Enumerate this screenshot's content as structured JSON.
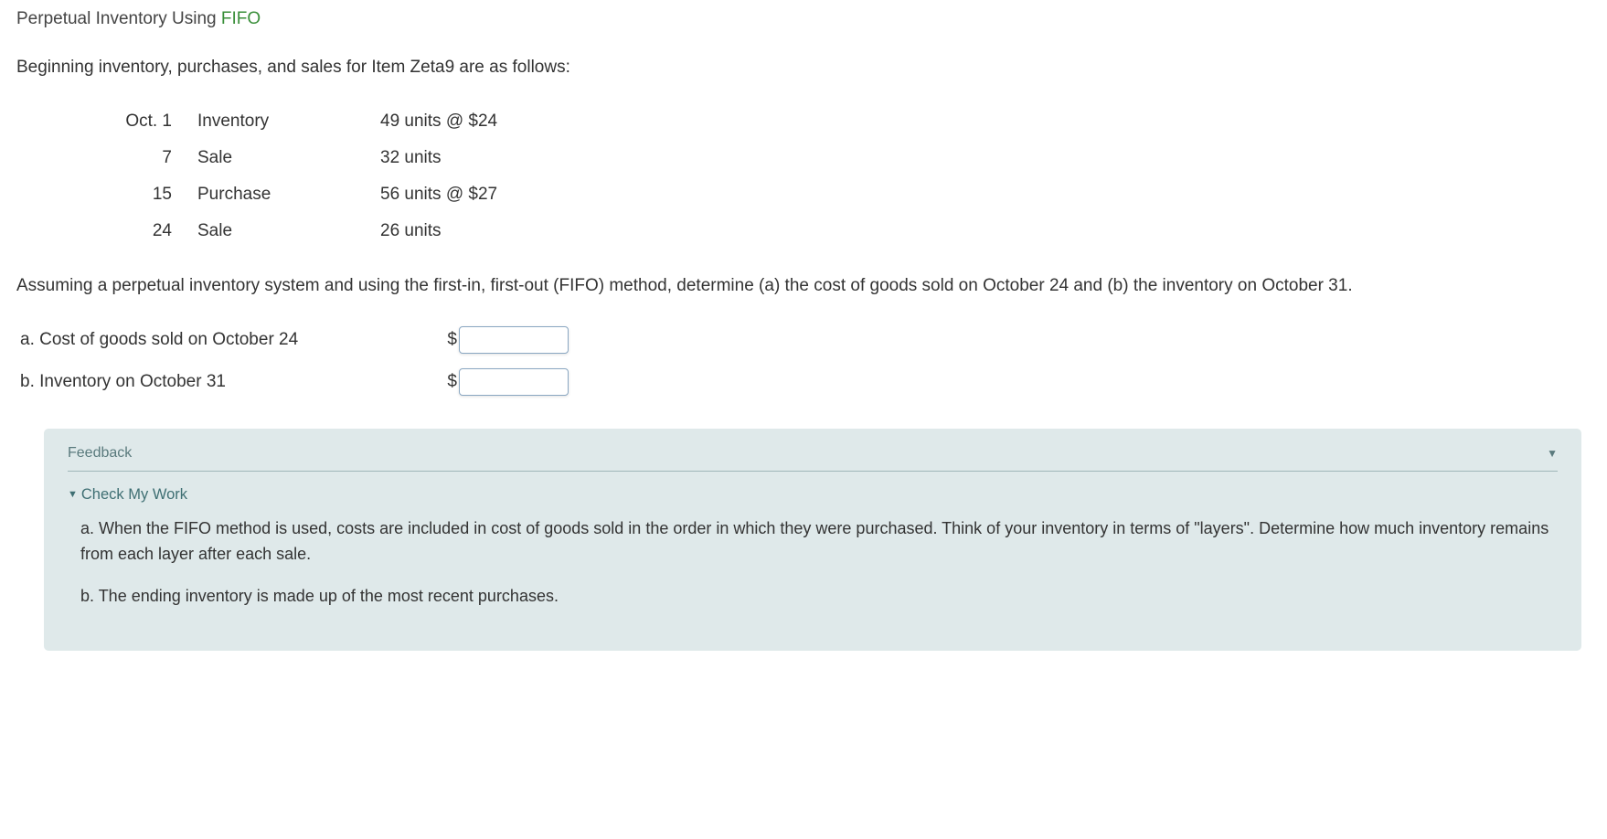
{
  "title_prefix": "Perpetual Inventory Using ",
  "title_highlight": "FIFO",
  "intro": "Beginning inventory, purchases, and sales for Item Zeta9 are as follows:",
  "rows": [
    {
      "date": "Oct. 1",
      "type": "Inventory",
      "detail": "49 units @ $24"
    },
    {
      "date": "7",
      "type": "Sale",
      "detail": "32 units"
    },
    {
      "date": "15",
      "type": "Purchase",
      "detail": "56 units @ $27"
    },
    {
      "date": "24",
      "type": "Sale",
      "detail": "26 units"
    }
  ],
  "instructions": "Assuming a perpetual inventory system and using the first-in, first-out (FIFO) method, determine (a) the cost of goods sold on October 24 and (b) the inventory on October 31.",
  "answers": {
    "a_label": "a. Cost of goods sold on October 24",
    "b_label": "b. Inventory on October 31",
    "currency": "$",
    "a_value": "",
    "b_value": ""
  },
  "feedback": {
    "title": "Feedback",
    "check_label": "Check My Work",
    "para_a": "a. When the FIFO method is used, costs are included in cost of goods sold in the order in which they were purchased. Think of your inventory in terms of \"layers\". Determine how much inventory remains from each layer after each sale.",
    "para_b": "b. The ending inventory is made up of the most recent purchases."
  }
}
